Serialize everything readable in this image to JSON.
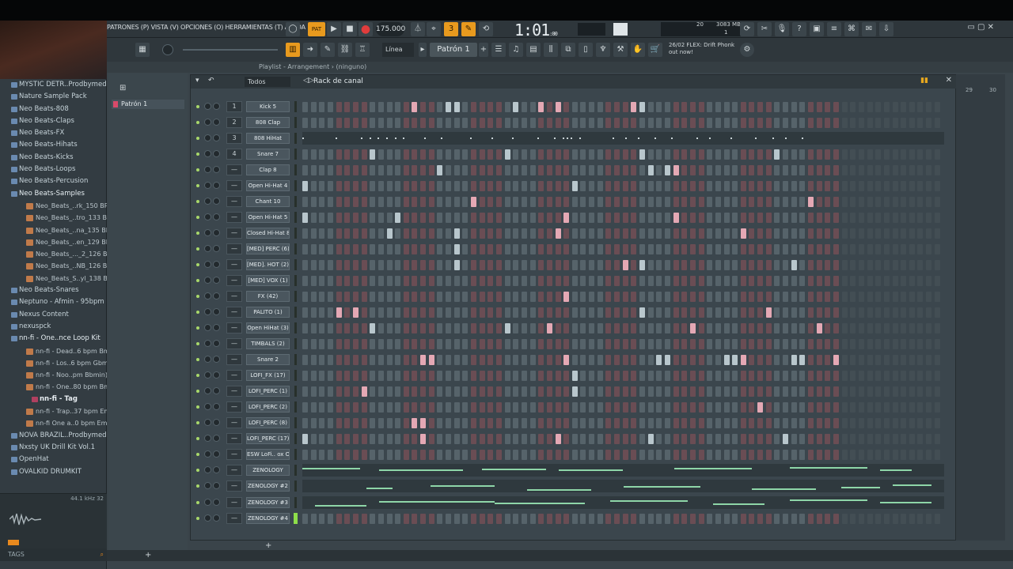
{
  "menu": {
    "text": "PATRONES (P) VISTA (V) OPCIONES (O) HERRAMIENTAS (T) AYUDA"
  },
  "transport": {
    "tempo": "175.000",
    "time": "1:01",
    "time_small": ":00",
    "pat_label": "PAT"
  },
  "cpu": {
    "line1": "20",
    "line2": "3083 MB",
    "line3": "1"
  },
  "toolbar2": {
    "snap": "Línea",
    "pattern": "Patrón 1",
    "news_line1": "26/02  FLEX: Drift Phonk",
    "news_line2": "out now!"
  },
  "playlist_bar": "Playlist - Arrangement › (ninguno)",
  "pattern_picker": {
    "item": "Patrón 1"
  },
  "rack": {
    "filter": "Todos",
    "title": "Rack de canal"
  },
  "browser": {
    "items": [
      {
        "label": "MYSTIC DETR..Prodbymed]",
        "type": "folder"
      },
      {
        "label": "Nature Sample Pack",
        "type": "folder"
      },
      {
        "label": "Neo Beats-808",
        "type": "folder"
      },
      {
        "label": "Neo Beats-Claps",
        "type": "folder"
      },
      {
        "label": "Neo Beats-FX",
        "type": "folder"
      },
      {
        "label": "Neo Beats-Hihats",
        "type": "folder"
      },
      {
        "label": "Neo Beats-Kicks",
        "type": "folder"
      },
      {
        "label": "Neo Beats-Loops",
        "type": "folder"
      },
      {
        "label": "Neo Beats-Percusion",
        "type": "folder"
      },
      {
        "label": "Neo Beats-Samples",
        "type": "folder-open"
      },
      {
        "label": "Neo_Beats_..rk_150 BPM",
        "type": "file"
      },
      {
        "label": "Neo_Beats_..tro_133 BPM",
        "type": "file"
      },
      {
        "label": "Neo_Beats_..na_135 BPM",
        "type": "file"
      },
      {
        "label": "Neo_Beats_..en_129 BPM",
        "type": "file"
      },
      {
        "label": "Neo_Beats_..._2_126 BPM",
        "type": "file"
      },
      {
        "label": "Neo_Beats_..NB_126 BPM",
        "type": "file"
      },
      {
        "label": "Neo_Beats_S..yl_138 BPM",
        "type": "file"
      },
      {
        "label": "Neo Beats-Snares",
        "type": "folder"
      },
      {
        "label": "Neptuno - Afmin - 95bpm",
        "type": "folder"
      },
      {
        "label": "Nexus Content",
        "type": "folder"
      },
      {
        "label": "nexuspck",
        "type": "folder"
      },
      {
        "label": "nn-fi - One..nce Loop Kit",
        "type": "folder-open"
      },
      {
        "label": "nn-fi - Dead..6 bpm Bmin)",
        "type": "file"
      },
      {
        "label": "nn-fi - Los..6 bpm Gbmin)",
        "type": "file"
      },
      {
        "label": "nn-fi - Noo..pm Bbmin)_1",
        "type": "file"
      },
      {
        "label": "nn-fi - One..80 bpm Bmin)",
        "type": "file"
      },
      {
        "label": "nn-fi - Tag",
        "type": "tag"
      },
      {
        "label": "nn-fi - Trap..37 bpm Emin)",
        "type": "file"
      },
      {
        "label": "nn-fi One a..0 bpm Emin)",
        "type": "file"
      },
      {
        "label": "NOVA BRAZIL..Prodbymed]",
        "type": "folder"
      },
      {
        "label": "Nxsty UK Drill Kit Vol.1",
        "type": "folder"
      },
      {
        "label": "OpenHat",
        "type": "folder"
      },
      {
        "label": "OVALKID DRUMKIT",
        "type": "folder"
      }
    ],
    "wave_info": "44.1 kHz 32",
    "tags_label": "TAGS"
  },
  "channels": [
    {
      "num": "1",
      "name": "Kick 5",
      "on": [
        26,
        34,
        35,
        50,
        55,
        59,
        78,
        79,
        80
      ]
    },
    {
      "num": "2",
      "name": "808 Clap",
      "on": []
    },
    {
      "num": "3",
      "name": "808 HiHat",
      "kind": "notes"
    },
    {
      "num": "4",
      "name": "Snare 7",
      "on": [
        16,
        48,
        80,
        112
      ]
    },
    {
      "num": "",
      "name": "Clap 8",
      "on": [
        32,
        82,
        86,
        87
      ]
    },
    {
      "num": "",
      "name": "Open Hi-Hat 4",
      "on": [
        0,
        64
      ]
    },
    {
      "num": "",
      "name": "Chant 10",
      "on": [
        40,
        119
      ]
    },
    {
      "num": "",
      "name": "Open Hi-Hat 5",
      "on": [
        0,
        22,
        62,
        88
      ]
    },
    {
      "num": "",
      "name": "Closed Hi-Hat 8",
      "on": [
        19,
        35,
        60,
        103
      ]
    },
    {
      "num": "",
      "name": "[MED] PERC (6)",
      "on": [
        35
      ]
    },
    {
      "num": "",
      "name": "[MED]. HOT (2)",
      "on": [
        35,
        76,
        80,
        116
      ]
    },
    {
      "num": "",
      "name": "[MED] VOX (1)",
      "on": []
    },
    {
      "num": "",
      "name": "FX (42)",
      "on": [
        62
      ]
    },
    {
      "num": "",
      "name": "PALITO (1)",
      "on": [
        8,
        12,
        80,
        110
      ]
    },
    {
      "num": "",
      "name": "Open HiHat (3)",
      "on": [
        16,
        48,
        58,
        92,
        121
      ]
    },
    {
      "num": "",
      "name": "TIMBALS (2)",
      "on": []
    },
    {
      "num": "",
      "name": "Snare 2",
      "on": [
        28,
        30,
        62,
        84,
        86,
        100,
        102,
        104,
        115,
        116,
        118,
        125,
        127
      ]
    },
    {
      "num": "",
      "name": "LOFI_FX (17)",
      "on": [
        64
      ]
    },
    {
      "num": "",
      "name": "LOFI_PERC (1)",
      "on": [
        14,
        64
      ]
    },
    {
      "num": "",
      "name": "LOFI_PERC (2)",
      "on": [
        108
      ]
    },
    {
      "num": "",
      "name": "LOFI_PERC (8)",
      "on": [
        26,
        28
      ]
    },
    {
      "num": "",
      "name": "LOFI_PERC (17)",
      "on": [
        0,
        28,
        60,
        82,
        114
      ]
    },
    {
      "num": "",
      "name": "ESW LoFi.. ox Off",
      "on": []
    },
    {
      "num": "",
      "name": "ZENOLOGY",
      "kind": "melody",
      "lines": [
        [
          0,
          0.09,
          9
        ],
        [
          0.12,
          0.25,
          7
        ],
        [
          0.28,
          0.38,
          8
        ],
        [
          0.4,
          0.5,
          7
        ],
        [
          0.58,
          0.7,
          9
        ],
        [
          0.76,
          0.88,
          10
        ],
        [
          0.9,
          0.95,
          7
        ]
      ]
    },
    {
      "num": "",
      "name": "ZENOLOGY #2",
      "kind": "melody",
      "lines": [
        [
          0.1,
          0.14,
          4
        ],
        [
          0.2,
          0.3,
          7
        ],
        [
          0.35,
          0.45,
          2
        ],
        [
          0.5,
          0.62,
          6
        ],
        [
          0.7,
          0.8,
          3
        ],
        [
          0.84,
          0.9,
          5
        ],
        [
          0.92,
          0.98,
          8
        ]
      ]
    },
    {
      "num": "",
      "name": "ZENOLOGY #3",
      "kind": "melody",
      "lines": [
        [
          0.02,
          0.1,
          3
        ],
        [
          0.12,
          0.3,
          8
        ],
        [
          0.3,
          0.44,
          6
        ],
        [
          0.48,
          0.6,
          9
        ],
        [
          0.64,
          0.72,
          5
        ],
        [
          0.76,
          0.88,
          10
        ],
        [
          0.9,
          0.98,
          7
        ]
      ]
    },
    {
      "num": "",
      "name": "ZENOLOGY #4",
      "on": [],
      "vol_on": true
    }
  ]
}
